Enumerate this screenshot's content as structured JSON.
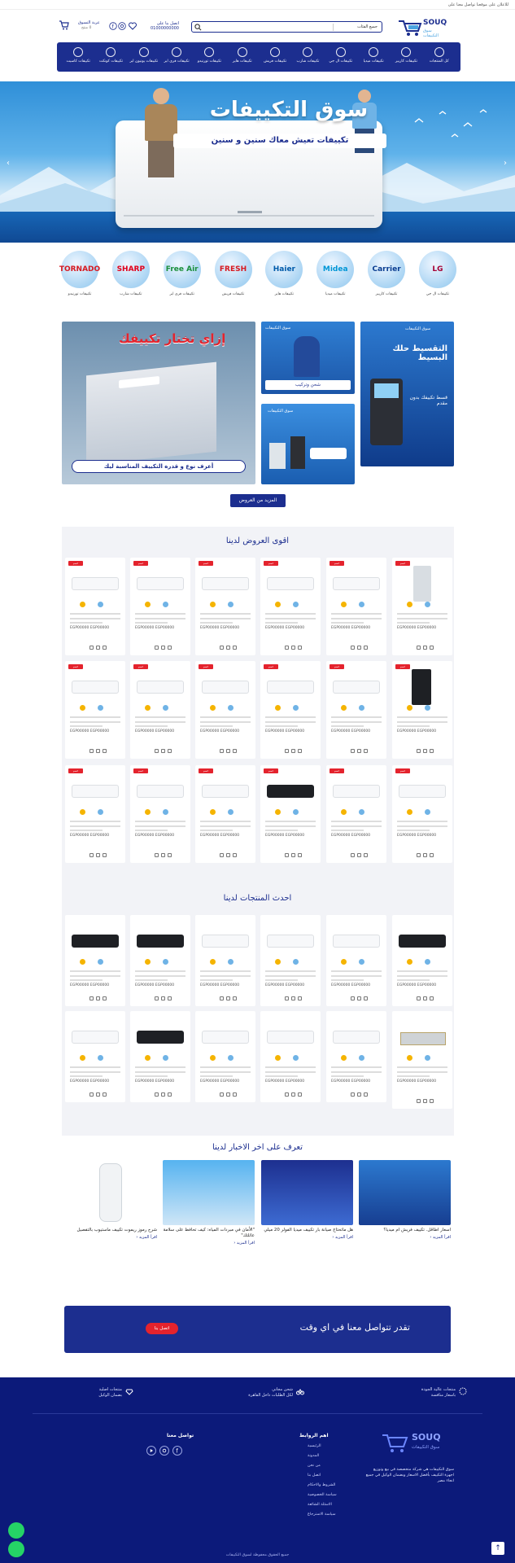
{
  "topbar": {
    "text": "للاعلان على موقعنا تواصل معنا على"
  },
  "header": {
    "logo_en": "SOUQ",
    "logo_ar": "سوق التكييفات",
    "search_category": "جميع الفئات",
    "search_placeholder": "",
    "phone_label": "اتصل بنا على",
    "phone_number": "01000000000",
    "cart_label": "عربة التسوق",
    "cart_sub": "0 منتج"
  },
  "nav": {
    "items": [
      "كل المنتجات",
      "تكييفات كاريير",
      "تكييفات ميديا",
      "تكييفات ال جي",
      "تكييفات شارب",
      "تكييفات فريش",
      "تكييفات هاير",
      "تكييفات تورنيدو",
      "تكييفات فري اير",
      "تكييفات يونيون اير",
      "تكييفات كونكت",
      "تكييفات كاسيت"
    ]
  },
  "hero": {
    "title": "سوق التكييفات",
    "subtitle": "تكييفات تعيش معاك سنين و سنين",
    "prev": "‹",
    "next": "›"
  },
  "brands": [
    {
      "logo": "LG",
      "label": "تكييفات ال جي",
      "color": "#a50034"
    },
    {
      "logo": "Carrier",
      "label": "تكييفات كاريير",
      "color": "#0a3d91"
    },
    {
      "logo": "Midea",
      "label": "تكييفات ميديا",
      "color": "#0096d6"
    },
    {
      "logo": "Haier",
      "label": "تكييفات هاير",
      "color": "#005baa"
    },
    {
      "logo": "FRESH",
      "label": "تكييفات فريش",
      "color": "#d71920"
    },
    {
      "logo": "Free Air",
      "label": "تكييفات فري اير",
      "color": "#1a8f3c"
    },
    {
      "logo": "SHARP",
      "label": "تكييفات شارب",
      "color": "#e2001a"
    },
    {
      "logo": "TORNADO",
      "label": "تكييفات تورنيدو",
      "color": "#d71920"
    }
  ],
  "promos": {
    "installment_title": "التقسيط حلك البسيط",
    "installment_sub": "قسط تكييفك بدون مقدم",
    "service_title": "شحن وتركيب",
    "souq_small": "سوق التكييفات",
    "choose_title": "إزاي تختار تكييفك",
    "choose_sub": "أعرف نوع و قدره التكييف المناسبة ليك",
    "more_offers": "المزيد من العروض"
  },
  "offers_title": "اقوى العروض لدينا",
  "latest_title": "احدث المنتجات لدينا",
  "product": {
    "badge": "خصم",
    "price_text": "EGP00000 EGP00000"
  },
  "news_title": "تعرف على اخر الاخبار لدينا",
  "news": [
    {
      "title": "اسعار اطاقل. تكييف فريش ام ميديا؟",
      "more": "اقرأ المزيد ‹"
    },
    {
      "title": "هل ماتحتاج صيانة بار تكييف ميديا الفولر 20 ميلي",
      "more": "اقرأ المزيد ‹"
    },
    {
      "title": "\"الأمان في مبردات المياه: كيف تحافظ على سلامة عائلتك\"",
      "more": "اقرأ المزيد ‹"
    },
    {
      "title": "شرح رموز ريموت تكييف ماستيوب بالتفصيل",
      "more": "اقرأ المزيد ‹"
    }
  ],
  "cta": {
    "text": "تقدر تتواصل معنا في اي وقت",
    "button": "اتصل بنا"
  },
  "footer": {
    "features": [
      {
        "title": "منتجات اصلية",
        "sub": "بضمان الوكيل"
      },
      {
        "title": "شحن مجاني",
        "sub": "لكل الطلبات داخل القاهرة"
      },
      {
        "title": "منتجات عالية الجودة",
        "sub": "باسعار منافسة"
      }
    ],
    "about": "سوق التكييفات هي شركة متخصصة في بيع وتوزيع اجهزة التكييف بأفضل الاسعار وبضمان الوكيل في جميع انحاء مصر",
    "links_title": "اهم الروابط",
    "links": [
      "الرئيسية",
      "المدونة",
      "من نحن",
      "اتصل بنا",
      "الشروط والاحكام",
      "سياسة الخصوصية",
      "الاسئلة الشائعة",
      "سياسة الاسترجاع"
    ],
    "contact_title": "تواصل معنا",
    "copyright": "جميع الحقوق محفوظة لسوق التكييفات"
  }
}
